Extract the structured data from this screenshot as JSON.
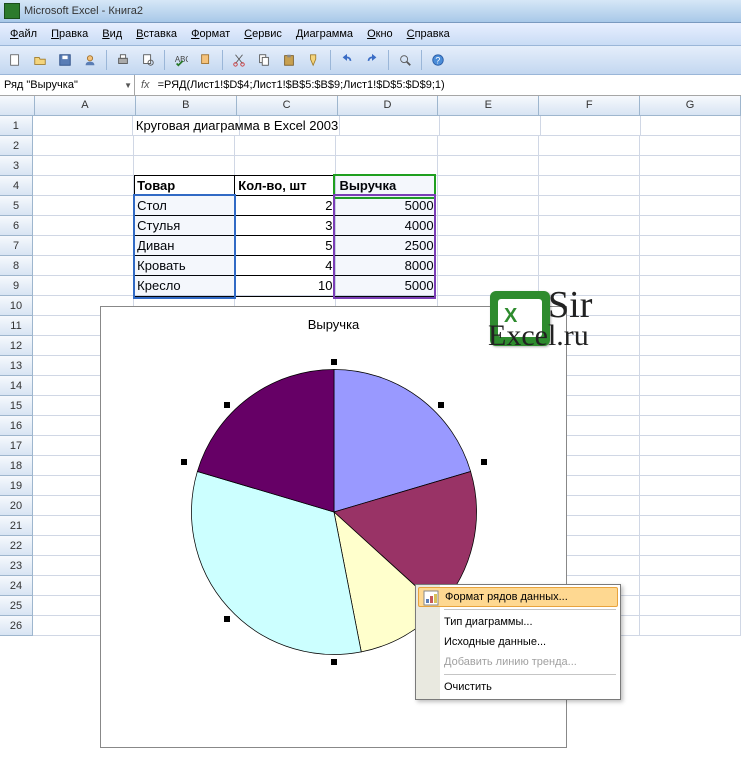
{
  "title": "Microsoft Excel - Книга2",
  "menu": [
    "Файл",
    "Правка",
    "Вид",
    "Вставка",
    "Формат",
    "Сервис",
    "Диаграмма",
    "Окно",
    "Справка"
  ],
  "namebox": "Ряд \"Выручка\"",
  "fx": "fx",
  "formula": "=РЯД(Лист1!$D$4;Лист1!$B$5:$B$9;Лист1!$D$5:$D$9;1)",
  "cols": [
    "A",
    "B",
    "C",
    "D",
    "E",
    "F",
    "G"
  ],
  "rows_count": 26,
  "cells": {
    "B1": "Круговая диаграмма в Excel 2003",
    "B4": "Товар",
    "C4": "Кол-во, шт",
    "D4": "Выручка",
    "B5": "Стол",
    "C5": "2",
    "D5": "5000",
    "B6": "Стулья",
    "C6": "3",
    "D6": "4000",
    "B7": "Диван",
    "C7": "5",
    "D7": "2500",
    "B8": "Кровать",
    "C8": "4",
    "D8": "8000",
    "B9": "Кресло",
    "C9": "10",
    "D9": "5000"
  },
  "chart_title": "Выручка",
  "context_menu": {
    "format": "Формат рядов данных...",
    "type": "Тип диаграммы...",
    "source": "Исходные данные...",
    "trend": "Добавить линию тренда...",
    "clear": "Очистить"
  },
  "context_menu_bar_left": "#f1f1f1",
  "watermark1": "Sir",
  "watermark2": "Excel.ru",
  "chart_data": {
    "type": "pie",
    "title": "Выручка",
    "categories": [
      "Стол",
      "Стулья",
      "Диван",
      "Кровать",
      "Кресло"
    ],
    "values": [
      5000,
      4000,
      2500,
      8000,
      5000
    ],
    "colors": [
      "#9999ff",
      "#993366",
      "#ffffcc",
      "#ccffff",
      "#660066"
    ]
  }
}
